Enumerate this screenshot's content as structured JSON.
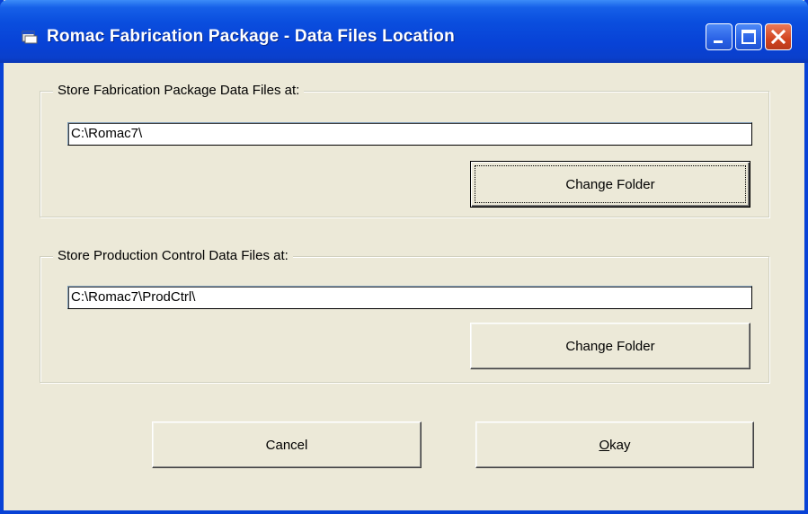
{
  "window": {
    "title": "Romac Fabrication Package - Data Files Location",
    "colors": {
      "titlebar": "#0842D6",
      "face": "#ECE9D8",
      "close": "#D2441F"
    }
  },
  "fabrication": {
    "legend": "Store Fabrication Package Data Files at:",
    "path": "C:\\Romac7\\",
    "change_label": "Change Folder"
  },
  "production": {
    "legend": "Store Production Control Data Files at:",
    "path": "C:\\Romac7\\ProdCtrl\\",
    "change_label": "Change Folder"
  },
  "actions": {
    "cancel_label": "Cancel",
    "okay_mnemonic": "O",
    "okay_rest": "kay"
  }
}
